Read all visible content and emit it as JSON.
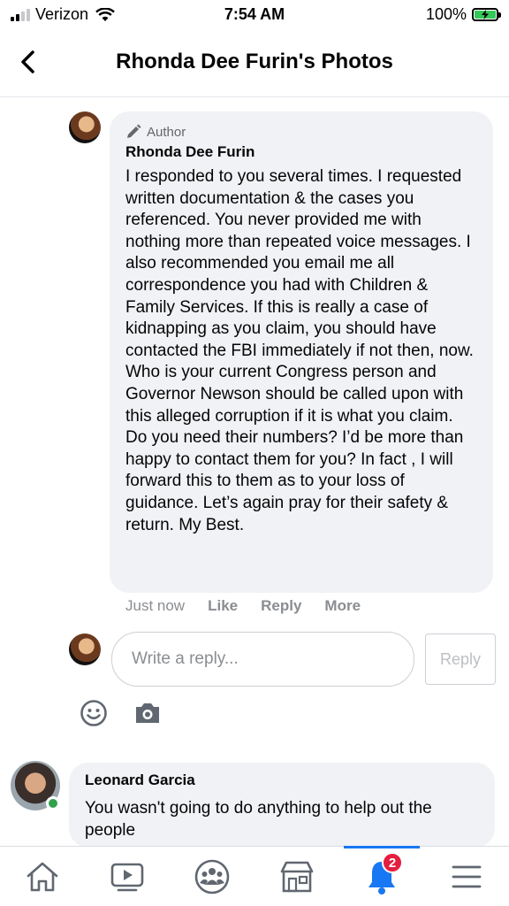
{
  "status_bar": {
    "carrier": "Verizon",
    "time": "7:54 AM",
    "battery": "100%",
    "signal_bars": 2,
    "battery_level": 1.0
  },
  "header": {
    "title": "Rhonda Dee Furin's Photos",
    "back_icon": "chevron-left-icon"
  },
  "comment": {
    "badge_icon": "pencil-icon",
    "badge_label": "Author",
    "author": "Rhonda Dee Furin",
    "text": "I responded to you several times. I requested written documentation & the cases you referenced. You never provided me with nothing more than repeated voice messages. I also recommended you email me all correspondence you had with Children & Family Services. If this is really a case of kidnapping as you claim, you should have contacted the FBI immediately if not then, now. Who is your current Congress person and Governor Newson should be called upon with this alleged corruption if it is what you claim. Do you need their numbers? I’d be more than happy to contact them for you? In fact , I will forward this to them as to your loss of guidance. Let’s again pray for their safety & return. My Best.",
    "timestamp": "Just now",
    "actions": [
      "Like",
      "Reply",
      "More"
    ]
  },
  "reply_box": {
    "placeholder": "Write a reply...",
    "button_label": "Reply",
    "emoji_icon": "smiley-icon",
    "camera_icon": "camera-icon"
  },
  "second_comment": {
    "author": "Leonard Garcia",
    "text": "You wasn't going to do anything to help out the people",
    "online": true
  },
  "tab_bar": {
    "tabs": [
      {
        "name": "home",
        "icon": "home-icon"
      },
      {
        "name": "watch",
        "icon": "video-icon"
      },
      {
        "name": "groups",
        "icon": "groups-icon"
      },
      {
        "name": "marketplace",
        "icon": "marketplace-icon"
      },
      {
        "name": "notifications",
        "icon": "bell-icon",
        "badge": "2",
        "active": true
      },
      {
        "name": "menu",
        "icon": "menu-icon"
      }
    ],
    "active_color": "#1877f2",
    "badge_color": "#e41e3f"
  }
}
